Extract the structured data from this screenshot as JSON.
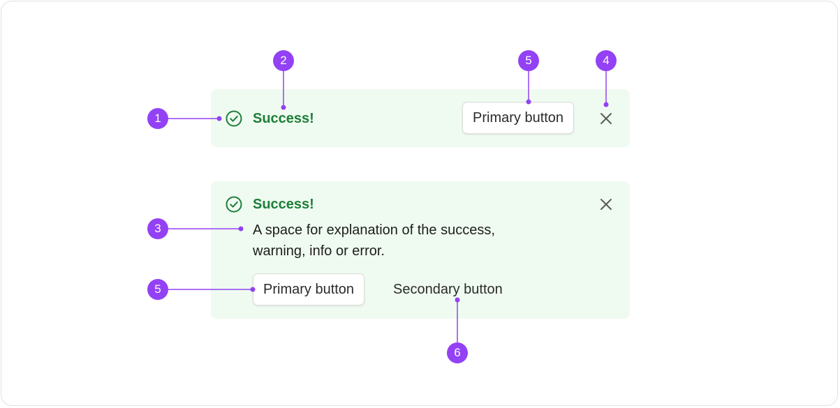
{
  "colors": {
    "alert_background": "#effbf0",
    "success_green": "#1e7d3a",
    "annotation_purple": "#9341f5"
  },
  "compact_alert": {
    "icon": "check-circle-icon",
    "title": "Success!",
    "primary_button": "Primary button",
    "close_icon": "close-icon"
  },
  "expanded_alert": {
    "icon": "check-circle-icon",
    "title": "Success!",
    "body": "A space for explanation of the success, warning, info or error.",
    "primary_button": "Primary button",
    "secondary_button": "Secondary button",
    "close_icon": "close-icon"
  },
  "callouts": [
    "1",
    "2",
    "5",
    "4",
    "3",
    "5",
    "6"
  ]
}
